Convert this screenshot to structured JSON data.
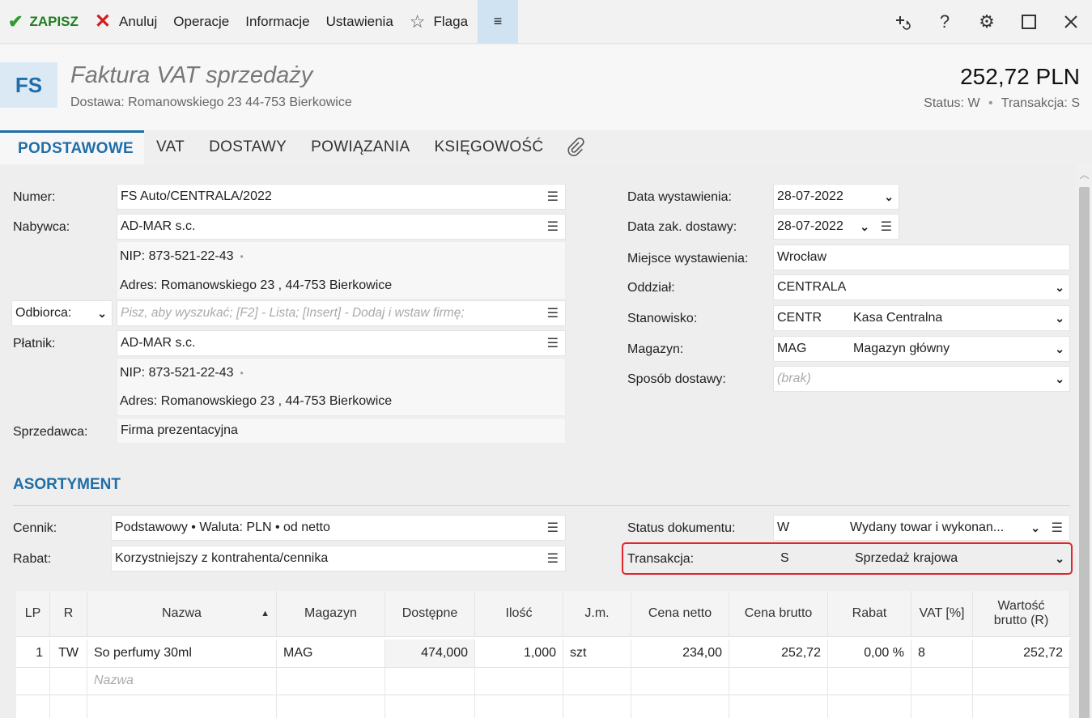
{
  "toolbar": {
    "save": "ZAPISZ",
    "cancel": "Anuluj",
    "operations": "Operacje",
    "information": "Informacje",
    "settings": "Ustawienia",
    "flag": "Flaga",
    "menu": "≡"
  },
  "header": {
    "badge": "FS",
    "title": "Faktura VAT sprzedaży",
    "subtitle": "Dostawa: Romanowskiego 23  44-753 Bierkowice",
    "amount": "252,72 PLN",
    "status_label": "Status:",
    "status_value": "W",
    "transaction_label": "Transakcja:",
    "transaction_value": "S"
  },
  "tabs": [
    "PODSTAWOWE",
    "VAT",
    "DOSTAWY",
    "POWIĄZANIA",
    "KSIĘGOWOŚĆ"
  ],
  "left_form": {
    "numer_label": "Numer:",
    "numer_value": "FS Auto/CENTRALA/2022",
    "nabywca_label": "Nabywca:",
    "nabywca_value": "AD-MAR s.c.",
    "nabywca_nip": "NIP:  873-521-22-43",
    "nabywca_adres": "Adres:  Romanowskiego 23 , 44-753 Bierkowice",
    "odbiorca_label": "Odbiorca:",
    "odbiorca_placeholder": "Pisz, aby wyszukać; [F2] - Lista; [Insert] - Dodaj i wstaw firmę;",
    "platnik_label": "Płatnik:",
    "platnik_value": "AD-MAR s.c.",
    "platnik_nip": "NIP:  873-521-22-43",
    "platnik_adres": "Adres:  Romanowskiego 23 , 44-753 Bierkowice",
    "sprzedawca_label": "Sprzedawca:",
    "sprzedawca_value": "Firma prezentacyjna"
  },
  "right_form": {
    "data_wyst_label": "Data wystawienia:",
    "data_wyst_value": "28-07-2022",
    "data_zak_label": "Data zak. dostawy:",
    "data_zak_value": "28-07-2022",
    "miejsce_label": "Miejsce wystawienia:",
    "miejsce_value": "Wrocław",
    "oddzial_label": "Oddział:",
    "oddzial_value": "CENTRALA",
    "stanowisko_label": "Stanowisko:",
    "stanowisko_code": "CENTR",
    "stanowisko_name": "Kasa Centralna",
    "magazyn_label": "Magazyn:",
    "magazyn_code": "MAG",
    "magazyn_name": "Magazyn główny",
    "sposob_label": "Sposób dostawy:",
    "sposob_placeholder": "(brak)"
  },
  "assortment": {
    "title": "ASORTYMENT",
    "cennik_label": "Cennik:",
    "cennik_value": "Podstawowy • Waluta: PLN • od netto",
    "rabat_label": "Rabat:",
    "rabat_value": "Korzystniejszy z kontrahenta/cennika",
    "status_label": "Status dokumentu:",
    "status_code": "W",
    "status_name": "Wydany towar i wykonan...",
    "transakcja_label": "Transakcja:",
    "transakcja_code": "S",
    "transakcja_name": "Sprzedaż krajowa"
  },
  "grid": {
    "headers": {
      "lp": "LP",
      "r": "R",
      "nazwa": "Nazwa",
      "magazyn": "Magazyn",
      "dostepne": "Dostępne",
      "ilosc": "Ilość",
      "jm": "J.m.",
      "cena_netto": "Cena netto",
      "cena_brutto": "Cena brutto",
      "rabat": "Rabat",
      "vat": "VAT [%]",
      "wartosc": "Wartość brutto (R)"
    },
    "row": {
      "lp": "1",
      "r": "TW",
      "nazwa": "So perfumy 30ml",
      "magazyn": "MAG",
      "dostepne": "474,000",
      "ilosc": "1,000",
      "jm": "szt",
      "cena_netto": "234,00",
      "cena_brutto": "252,72",
      "rabat": "0,00 %",
      "vat": "8",
      "wartosc": "252,72"
    },
    "new_row_placeholder": "Nazwa"
  }
}
